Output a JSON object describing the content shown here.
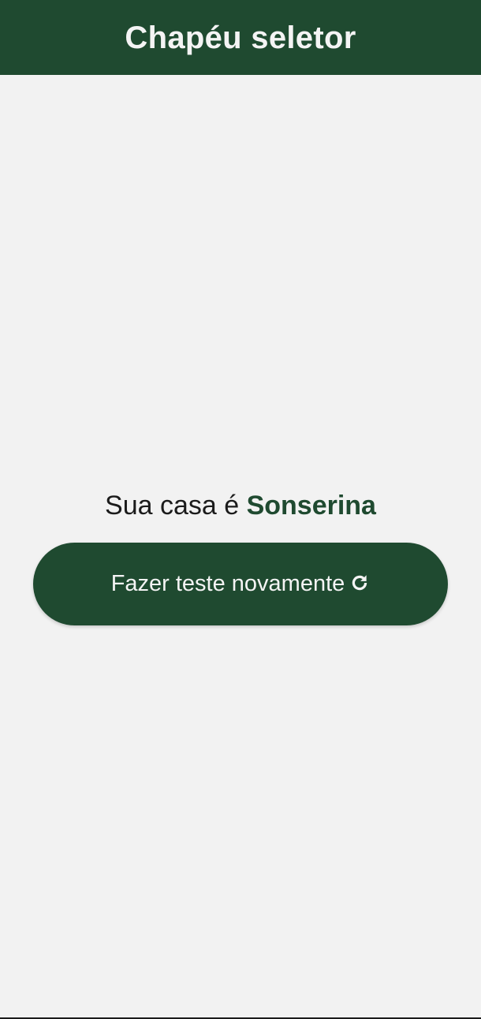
{
  "header": {
    "title": "Chapéu seletor"
  },
  "result": {
    "prefix": "Sua casa é ",
    "house": "Sonserina"
  },
  "actions": {
    "retry_label": "Fazer teste novamente",
    "retry_icon": "refresh-icon"
  },
  "colors": {
    "primary": "#1f4a30",
    "background": "#f2f2f2",
    "text": "#1b1b1b",
    "on_primary": "#f4f4f4"
  }
}
